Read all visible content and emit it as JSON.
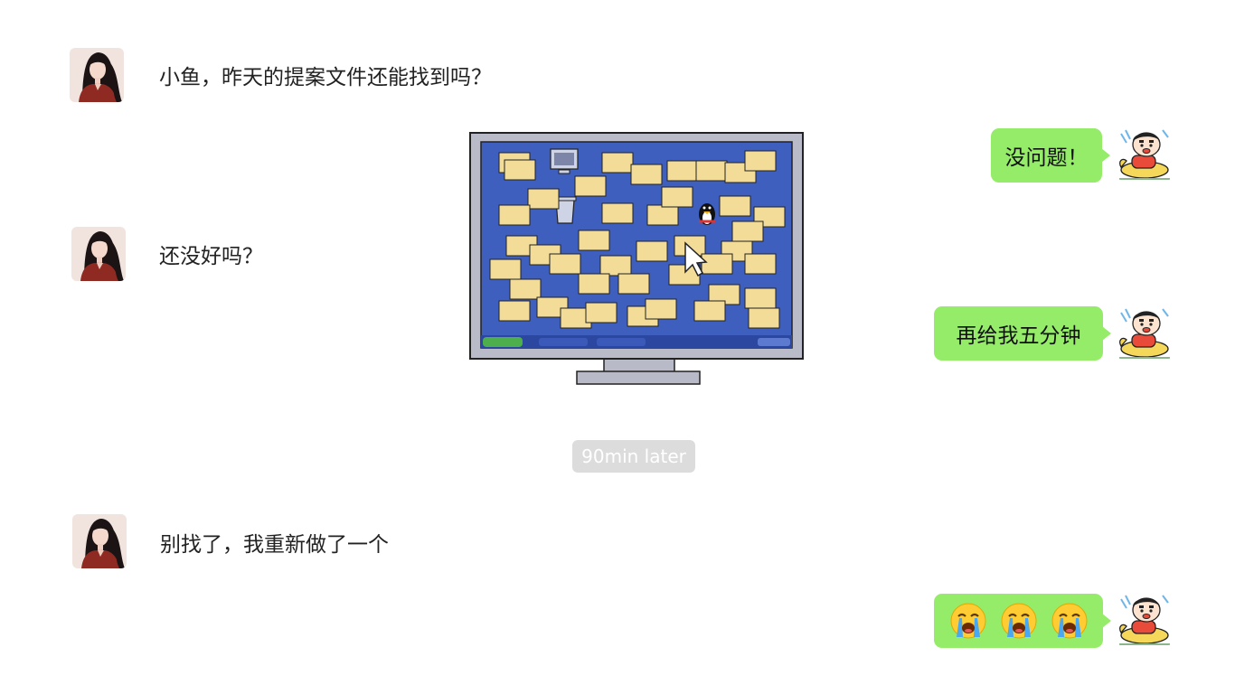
{
  "conversation": {
    "messages": [
      {
        "side": "left",
        "text": "小鱼，昨天的提案文件还能找到吗？"
      },
      {
        "side": "right",
        "text": "没问题！"
      },
      {
        "side": "left",
        "text": "还没好吗？"
      },
      {
        "side": "right",
        "text": "再给我五分钟"
      },
      {
        "side": "left",
        "text": "别找了，我重新做了一个"
      }
    ],
    "timestamp": "90min later",
    "last_reply_emoji": [
      "loudly-crying-face",
      "loudly-crying-face",
      "loudly-crying-face"
    ]
  },
  "colors": {
    "bubble_green": "#95ec69",
    "timestamp_bg": "#dcdcdc",
    "desktop_blue": "#3f5fbf",
    "folder_yellow": "#f2dc98"
  }
}
